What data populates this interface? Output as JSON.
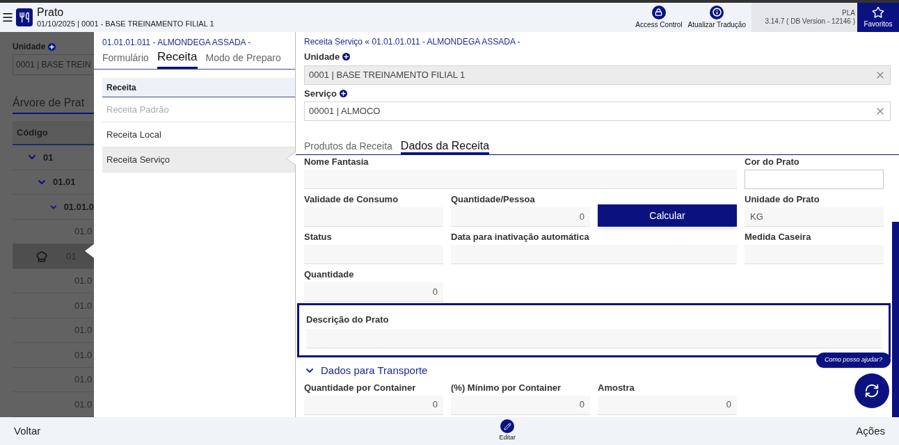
{
  "header": {
    "title": "Prato",
    "subtitle": "01/10/2025 | 0001 - BASE TREINAMENTO FILIAL 1",
    "actions": [
      {
        "label": "Access Control",
        "kind": "lock"
      },
      {
        "label": "Atualizar Tradução",
        "kind": "info"
      }
    ],
    "version": [
      "PLA",
      "3.14.7 ( DB Version - 12146 )"
    ],
    "favorites": "Favoritos"
  },
  "left_panel": {
    "unit_label": "Unidade",
    "unit_value": "0001 | BASE TREIN",
    "tree_title": "Árvore de Prat",
    "column": "Código",
    "tree": [
      {
        "label": "01",
        "selected": false,
        "expanded": true,
        "children": [
          {
            "label": "01.01",
            "selected": false,
            "expanded": true,
            "children": [
              {
                "label": "01.01.0",
                "selected": false,
                "expanded": true,
                "children": [
                  {
                    "label": "01.0",
                    "selected": false
                  },
                  {
                    "label": "01",
                    "selected": true
                  },
                  {
                    "label": "01.0",
                    "selected": false
                  },
                  {
                    "label": "01.0",
                    "selected": false
                  },
                  {
                    "label": "01.0",
                    "selected": false
                  },
                  {
                    "label": "01.0",
                    "selected": false
                  },
                  {
                    "label": "01.0",
                    "selected": false
                  },
                  {
                    "label": "01.0",
                    "selected": false
                  }
                ]
              }
            ]
          }
        ]
      }
    ]
  },
  "middle_panel": {
    "breadcrumb": "01.01.01.011 - ALMONDEGA ASSADA -",
    "tabs": [
      {
        "label": "Formulário",
        "selected": false
      },
      {
        "label": "Receita",
        "selected": true
      },
      {
        "label": "Modo de Preparo",
        "selected": false
      }
    ],
    "list_header": "Receita",
    "items": [
      {
        "label": "Receita Padrão",
        "selected": false,
        "disabled": true
      },
      {
        "label": "Receita Local",
        "selected": false,
        "disabled": false
      },
      {
        "label": "Receita Serviço",
        "selected": true,
        "disabled": false
      }
    ]
  },
  "detail": {
    "breadcrumb": "Receita Serviço « 01.01.01.011 - ALMONDEGA ASSADA -",
    "lookups": [
      {
        "label": "Unidade",
        "value": "0001 | BASE TREINAMENTO FILIAL 1",
        "disabled": true
      },
      {
        "label": "Serviço",
        "value": "00001 | ALMOCO",
        "disabled": false
      }
    ],
    "tabs": [
      {
        "label": "Produtos da Receita",
        "selected": false
      },
      {
        "label": "Dados da Receita",
        "selected": true
      }
    ],
    "rows": [
      [
        {
          "kind": "text",
          "label": "Nome Fantasia"
        },
        "",
        "",
        {
          "kind": "color",
          "label": "Cor do Prato"
        }
      ],
      [
        {
          "kind": "text",
          "label": "Validade de Consumo"
        },
        {
          "kind": "number",
          "label": "Quantidade/Pessoa",
          "value": "0"
        },
        {
          "kind": "button",
          "label": "Calcular"
        },
        {
          "kind": "text",
          "label": "Unidade do Prato",
          "value": "KG"
        }
      ],
      [
        {
          "kind": "text",
          "label": "Status"
        },
        {
          "kind": "text",
          "label": "Data para inativação automática"
        },
        "",
        {
          "kind": "text",
          "label": "Medida Caseira"
        }
      ],
      [
        {
          "kind": "number",
          "label": "Quantidade",
          "value": "0"
        }
      ]
    ],
    "description": {
      "label": "Descrição do Prato",
      "focused": true
    },
    "transport": {
      "title": "Dados para Transporte",
      "expanded": true,
      "fields": [
        {
          "kind": "number",
          "label": "Quantidade por Container",
          "value": "0"
        },
        {
          "kind": "number",
          "label": "(%) Mínimo por Container",
          "value": "0"
        },
        {
          "kind": "number",
          "label": "Amostra",
          "value": "0"
        }
      ]
    }
  },
  "help_bubble": "Como posso ajudar?",
  "bottom_bar": {
    "back": "Voltar",
    "edit": "Editar",
    "actions": "Ações"
  }
}
